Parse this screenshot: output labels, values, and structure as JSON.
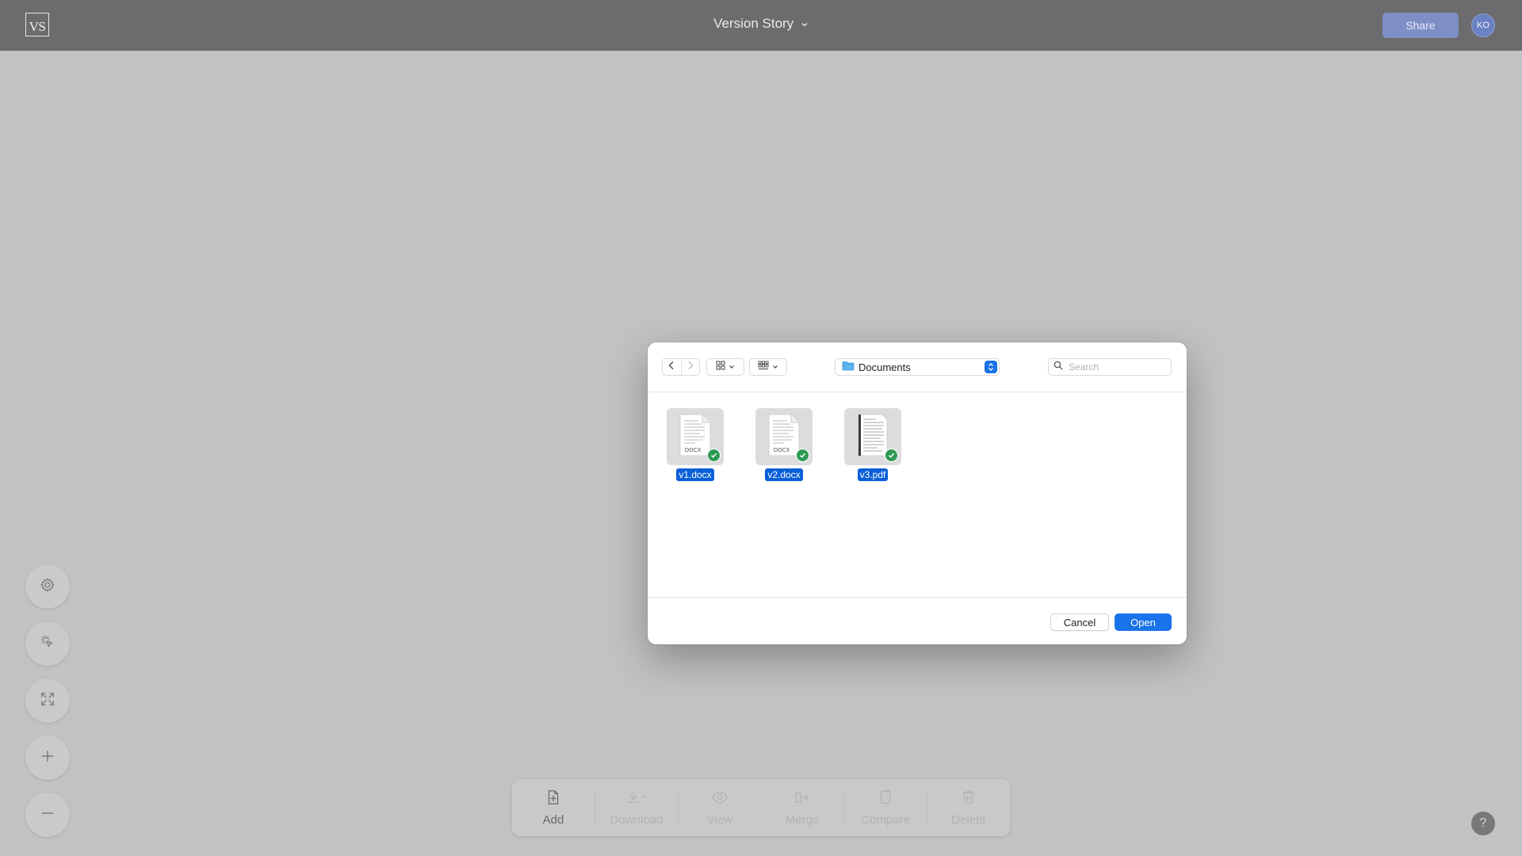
{
  "app": {
    "logo_text": "VS",
    "document_title": "Version Story",
    "share_label": "Share",
    "avatar_initials": "KO"
  },
  "left_tools": [
    {
      "name": "settings",
      "icon": "gear-icon"
    },
    {
      "name": "magic-select",
      "icon": "cursor-sparkle-icon"
    },
    {
      "name": "fit-screen",
      "icon": "expand-icon"
    },
    {
      "name": "zoom-in",
      "icon": "plus-icon"
    },
    {
      "name": "zoom-out",
      "icon": "minus-icon"
    }
  ],
  "bottom_toolbar": {
    "items": [
      {
        "label": "Add",
        "icon": "file-plus-icon",
        "enabled": true
      },
      {
        "label": "Download",
        "icon": "download-icon",
        "enabled": false
      },
      {
        "label": "View",
        "icon": "eye-icon",
        "enabled": false
      },
      {
        "label": "Merge",
        "icon": "merge-icon",
        "enabled": false
      },
      {
        "label": "Compare",
        "icon": "compare-icon",
        "enabled": false
      },
      {
        "label": "Delete",
        "icon": "trash-icon",
        "enabled": false
      }
    ]
  },
  "help_label": "?",
  "dialog": {
    "location": "Documents",
    "search_placeholder": "Search",
    "files": [
      {
        "name": "v1.docx",
        "type_label": "DOCX",
        "selected": true
      },
      {
        "name": "v2.docx",
        "type_label": "DOCX",
        "selected": true
      },
      {
        "name": "v3.pdf",
        "type_label": "",
        "selected": true
      }
    ],
    "cancel_label": "Cancel",
    "open_label": "Open"
  },
  "colors": {
    "topbar": "#6c6c6e",
    "overlay_bg": "#c2c2c4",
    "accent_blue": "#1a73e8",
    "selection_blue": "#0a5fd7",
    "check_green": "#2d9a52"
  }
}
